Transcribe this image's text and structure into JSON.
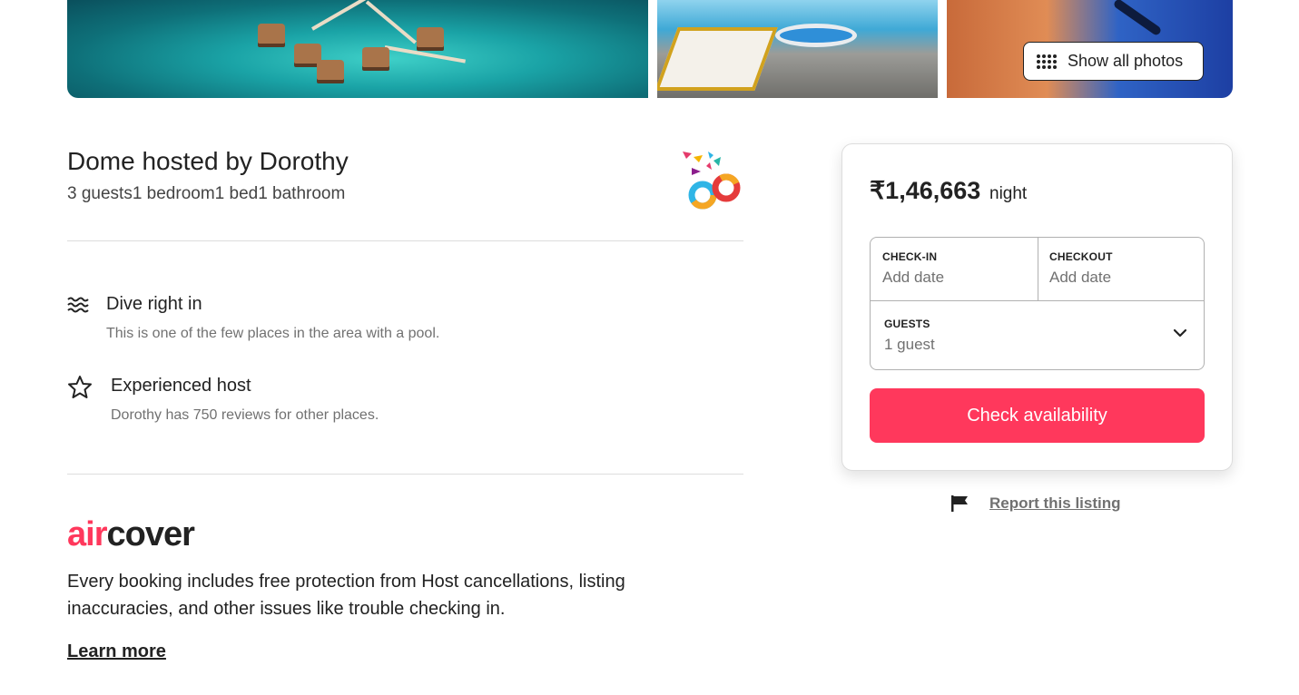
{
  "photos": {
    "show_all_label": "Show all photos"
  },
  "listing": {
    "title": "Dome hosted by Dorothy",
    "details": "3 guests1 bedroom1 bed1 bathroom"
  },
  "features": [
    {
      "icon": "waves-icon",
      "title": "Dive right in",
      "description": "This is one of the few places in the area with a pool."
    },
    {
      "icon": "star-icon",
      "title": "Experienced host",
      "description": "Dorothy has 750 reviews for other places."
    }
  ],
  "aircover": {
    "logo_air": "air",
    "logo_cover": "cover",
    "description": "Every booking includes free protection from Host cancellations, listing inaccuracies, and other issues like trouble checking in.",
    "learn_more": "Learn more"
  },
  "booking": {
    "price": "₹1,46,663",
    "price_unit": "night",
    "checkin_label": "CHECK-IN",
    "checkin_value": "Add date",
    "checkout_label": "CHECKOUT",
    "checkout_value": "Add date",
    "guests_label": "GUESTS",
    "guests_value": "1 guest",
    "cta": "Check availability",
    "accent_color": "#ff385c"
  },
  "report": {
    "label": "Report this listing"
  }
}
